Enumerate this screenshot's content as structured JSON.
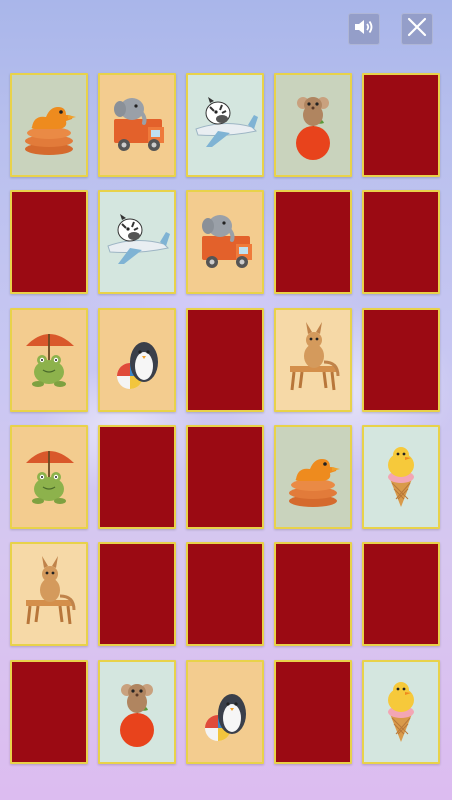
{
  "toolbar": {
    "sound_icon": "speaker-icon",
    "close_icon": "close-icon"
  },
  "colors": {
    "card_back": "#9b0a13",
    "card_border": "#e8d24a",
    "toolbar_button": "#8c96be"
  },
  "board": {
    "columns": 5,
    "rows": 6,
    "cards": [
      {
        "state": "face",
        "picture": "duck-on-sausages",
        "tone": "sage"
      },
      {
        "state": "face",
        "picture": "elephant-in-truck",
        "tone": "peach"
      },
      {
        "state": "face",
        "picture": "zebra-on-airplane",
        "tone": "mint"
      },
      {
        "state": "face",
        "picture": "mouse-on-apple",
        "tone": "sage"
      },
      {
        "state": "back"
      },
      {
        "state": "back"
      },
      {
        "state": "face",
        "picture": "zebra-on-airplane",
        "tone": "mint"
      },
      {
        "state": "face",
        "picture": "elephant-in-truck",
        "tone": "peach"
      },
      {
        "state": "back"
      },
      {
        "state": "back"
      },
      {
        "state": "face",
        "picture": "frog-with-umbrella",
        "tone": "peach"
      },
      {
        "state": "face",
        "picture": "penguin-with-ball",
        "tone": "peach"
      },
      {
        "state": "back"
      },
      {
        "state": "face",
        "picture": "kangaroo-at-desk",
        "tone": "cream"
      },
      {
        "state": "back"
      },
      {
        "state": "face",
        "picture": "frog-with-umbrella",
        "tone": "peach"
      },
      {
        "state": "back"
      },
      {
        "state": "back"
      },
      {
        "state": "face",
        "picture": "duck-on-sausages",
        "tone": "sage"
      },
      {
        "state": "face",
        "picture": "chick-in-ice-cream-cone",
        "tone": "mint"
      },
      {
        "state": "face",
        "picture": "kangaroo-at-desk",
        "tone": "cream"
      },
      {
        "state": "back"
      },
      {
        "state": "back"
      },
      {
        "state": "back"
      },
      {
        "state": "back"
      },
      {
        "state": "back"
      },
      {
        "state": "face",
        "picture": "mouse-on-apple",
        "tone": "mint"
      },
      {
        "state": "face",
        "picture": "penguin-with-ball",
        "tone": "peach"
      },
      {
        "state": "back"
      },
      {
        "state": "face",
        "picture": "chick-in-ice-cream-cone",
        "tone": "mint"
      }
    ]
  }
}
